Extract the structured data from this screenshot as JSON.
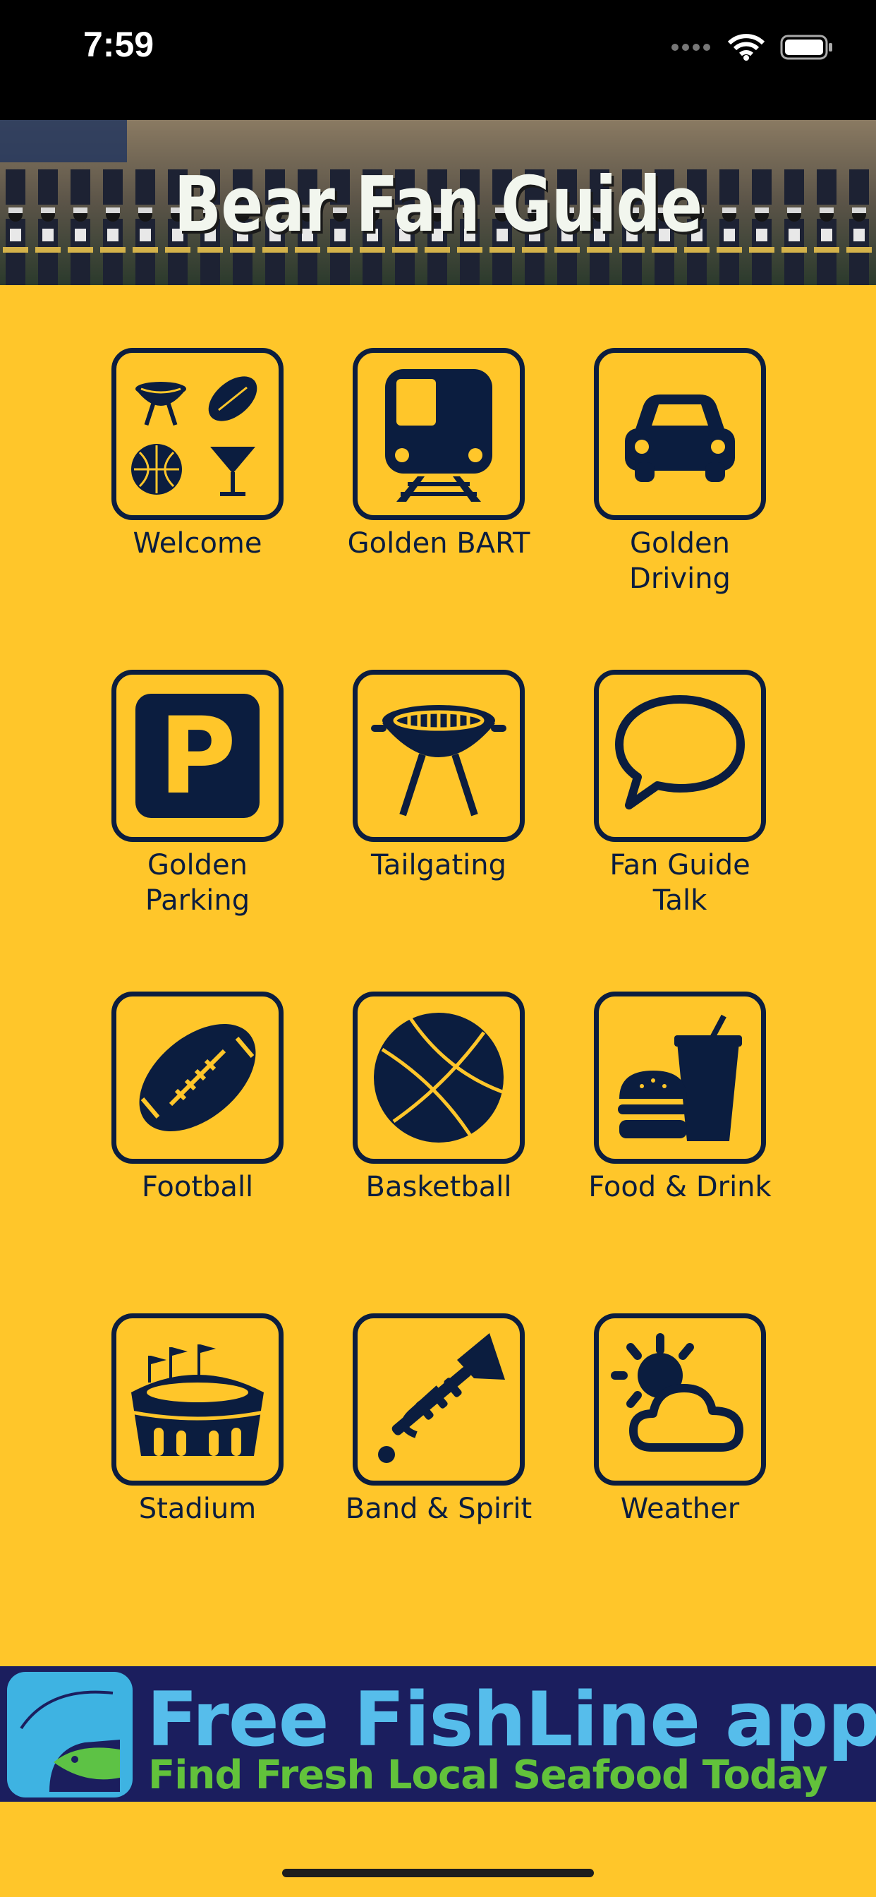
{
  "status": {
    "time": "7:59"
  },
  "banner": {
    "title": "Bear Fan Guide"
  },
  "tiles": [
    {
      "label": "Welcome"
    },
    {
      "label": "Golden BART"
    },
    {
      "label": "Golden\nDriving"
    },
    {
      "label": "Golden\nParking"
    },
    {
      "label": "Tailgating"
    },
    {
      "label": "Fan Guide\nTalk"
    },
    {
      "label": "Football"
    },
    {
      "label": "Basketball"
    },
    {
      "label": "Food & Drink"
    },
    {
      "label": "Stadium"
    },
    {
      "label": "Band & Spirit"
    },
    {
      "label": "Weather"
    }
  ],
  "ad": {
    "line1": "Free FishLine app",
    "line2": "Find Fresh Local Seafood Today"
  },
  "colors": {
    "background": "#FFC62A",
    "navy": "#0B1D3F",
    "ad_bg": "#1B1E5E"
  }
}
